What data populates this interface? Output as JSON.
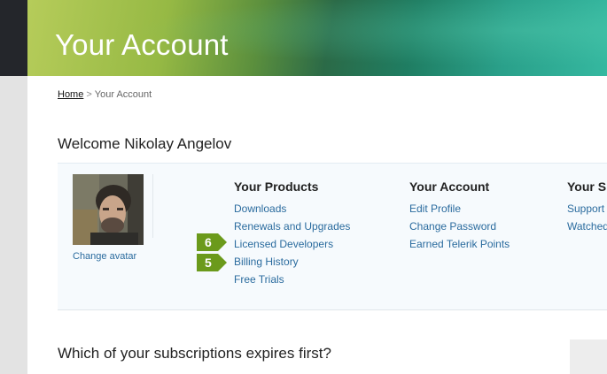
{
  "header": {
    "title": "Your Account"
  },
  "breadcrumb": {
    "home": "Home",
    "separator": ">",
    "current": "Your Account"
  },
  "welcome": "Welcome Nikolay Angelov",
  "avatar": {
    "change_label": "Change avatar"
  },
  "columns": [
    {
      "heading": "Your Products",
      "links": [
        "Downloads",
        "Renewals and Upgrades",
        "Licensed Developers",
        "Billing History",
        "Free Trials"
      ]
    },
    {
      "heading": "Your Account",
      "links": [
        "Edit Profile",
        "Change Password",
        "Earned Telerik Points"
      ]
    },
    {
      "heading": "Your S",
      "links": [
        "Support",
        "Watched"
      ]
    }
  ],
  "markers": [
    {
      "label": "6",
      "color": "#6b9a1b"
    },
    {
      "label": "5",
      "color": "#6b9a1b"
    }
  ],
  "subscriptions": {
    "title": "Which of your subscriptions expires first?"
  },
  "colors": {
    "link": "#2a6b9e",
    "panel_bg": "#f6fafd",
    "marker": "#6b9a1b"
  }
}
